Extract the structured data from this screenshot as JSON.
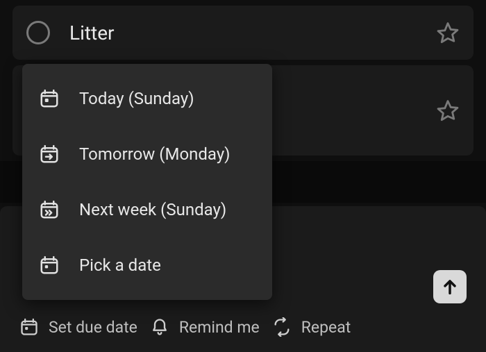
{
  "task": {
    "title": "Litter"
  },
  "popup": {
    "items": [
      {
        "label": "Today (Sunday)",
        "icon": "calendar-today-icon"
      },
      {
        "label": "Tomorrow (Monday)",
        "icon": "calendar-arrow-icon"
      },
      {
        "label": "Next week (Sunday)",
        "icon": "calendar-forward-icon"
      },
      {
        "label": "Pick a date",
        "icon": "calendar-icon"
      }
    ]
  },
  "toolbar": {
    "due": "Set due date",
    "remind": "Remind me",
    "repeat": "Repeat"
  }
}
